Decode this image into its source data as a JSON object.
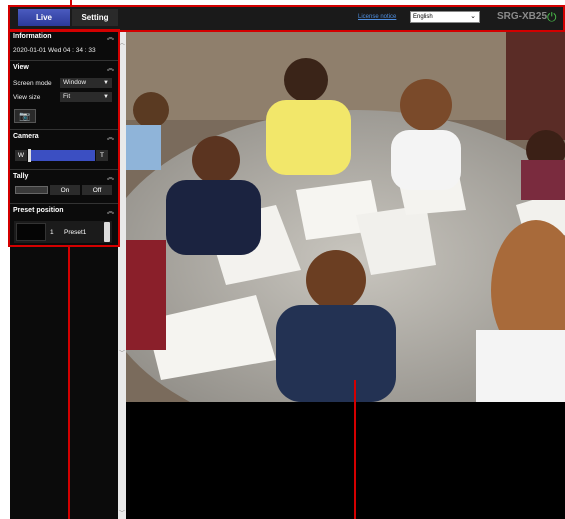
{
  "header": {
    "tabs": [
      {
        "label": "Live",
        "active": true
      },
      {
        "label": "Setting",
        "active": false
      }
    ],
    "license_link": "License notice",
    "language": "English",
    "model": "SRG-XB25",
    "power_icon": "power-icon"
  },
  "sidebar": {
    "information": {
      "title": "Information",
      "datetime": "2020-01-01 Wed 04 : 34 : 33"
    },
    "view": {
      "title": "View",
      "screen_mode_label": "Screen mode",
      "screen_mode_value": "Window",
      "view_size_label": "View size",
      "view_size_value": "Fit",
      "capture_icon": "camera-icon"
    },
    "camera": {
      "title": "Camera",
      "wide_label": "W",
      "tele_label": "T",
      "zoom_position": 0.0
    },
    "tally": {
      "title": "Tally",
      "on_label": "On",
      "off_label": "Off"
    },
    "preset_position": {
      "title": "Preset position",
      "items": [
        {
          "number": "1",
          "name": "Preset1"
        }
      ]
    }
  },
  "colors": {
    "callout": "#d40000",
    "tab_active": "#3b4fc2",
    "power": "#4cc24c"
  }
}
